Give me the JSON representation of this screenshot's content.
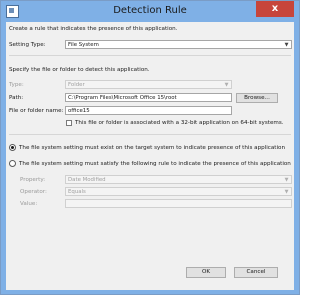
{
  "window": {
    "title": "Detection Rule",
    "close_label": "x"
  },
  "intro": "Create a rule that indicates the presence of this application.",
  "setting_type": {
    "label": "Setting Type:",
    "value": "File System"
  },
  "detect_heading": "Specify the file or folder to detect this application.",
  "type": {
    "label": "Type:",
    "value": "Folder"
  },
  "path": {
    "label": "Path:",
    "value": "C:\\Program Files\\Microsoft Office 15\\root",
    "browse_label": "Browse..."
  },
  "file_or_folder": {
    "label": "File or folder name:",
    "value": "office15"
  },
  "checkbox_32bit": {
    "label": "This file or folder is associated with a 32-bit application on 64-bit systems.",
    "checked": false
  },
  "radio_exist": {
    "label": "The file system setting must exist on the target system to indicate presence of this application",
    "selected": true
  },
  "radio_rule": {
    "label": "The file system setting must satisfy the following rule to indicate the presence of this application",
    "selected": false
  },
  "property": {
    "label": "Property:",
    "value": "Date Modified"
  },
  "operator": {
    "label": "Operator:",
    "value": "Equals"
  },
  "value_field": {
    "label": "Value:",
    "value": ""
  },
  "footer": {
    "ok_label": "OK",
    "cancel_label": "Cancel"
  }
}
